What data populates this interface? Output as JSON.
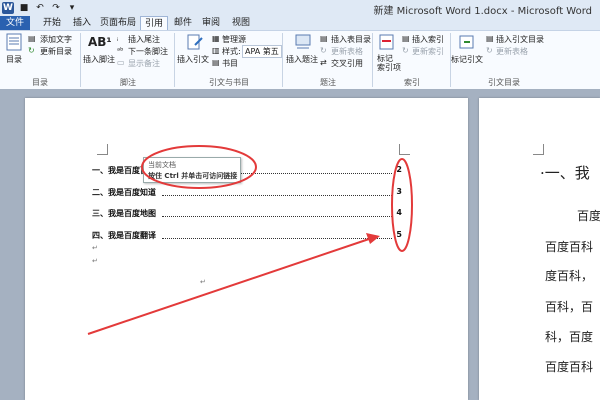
{
  "window": {
    "title": "新建 Microsoft Word 1.docx - Microsoft Word"
  },
  "tabs": [
    "文件",
    "开始",
    "插入",
    "页面布局",
    "引用",
    "邮件",
    "审阅",
    "视图"
  ],
  "ribbon": {
    "toc": {
      "button": "目录",
      "add_text": "添加文字",
      "update_toc": "更新目录",
      "group": "目录"
    },
    "footnotes": {
      "insert_footnote": "插入脚注",
      "insert_endnote": "插入尾注",
      "next_footnote": "下一条脚注",
      "show_notes": "显示备注",
      "group": "脚注"
    },
    "citations": {
      "insert_citation": "插入引文",
      "manage_sources": "管理源",
      "style_label": "样式:",
      "style_value": "APA 第五",
      "bibliography": "书目",
      "group": "引文与书目"
    },
    "captions": {
      "insert_caption": "插入题注",
      "insert_table_of_figures": "插入表目录",
      "update_table": "更新表格",
      "cross_reference": "交叉引用",
      "group": "题注"
    },
    "index": {
      "mark_entry": "标记\n索引项",
      "insert_index": "插入索引",
      "update_index": "更新索引",
      "group": "索引"
    },
    "table_of_authorities": {
      "mark_citation": "标记引文",
      "insert_toa": "插入引文目录",
      "update_table": "更新表格",
      "group": "引文目录"
    }
  },
  "document": {
    "toc_entries": [
      {
        "label": "一、我是百度百科",
        "page": "2"
      },
      {
        "label": "二、我是百度知道",
        "page": "3"
      },
      {
        "label": "三、我是百度地图",
        "page": "4"
      },
      {
        "label": "四、我是百度翻译",
        "page": "5"
      }
    ],
    "tooltip": {
      "line1": "当前文档",
      "line2": "按住 Ctrl 并单击可访问链接"
    },
    "page2": {
      "heading": "·一、我",
      "lines": [
        "百度",
        "百度百科",
        "度百科，",
        "百科，百",
        "科，百度",
        "百度百科"
      ]
    }
  },
  "colors": {
    "annotation": "#e33a3a",
    "file_tab": "#2a61b0"
  }
}
